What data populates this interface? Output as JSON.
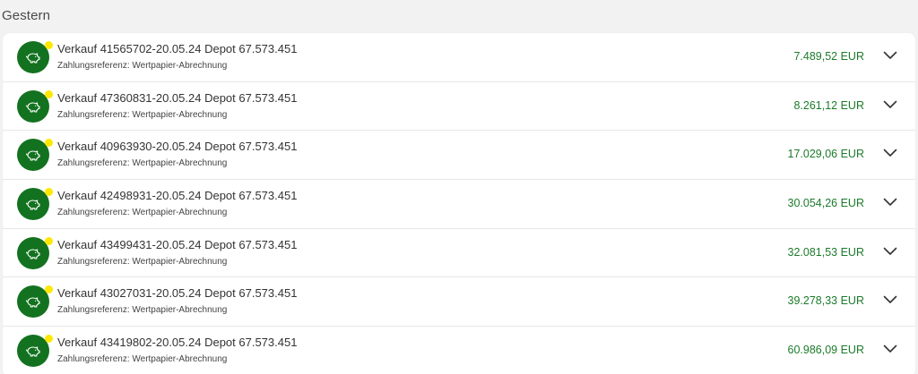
{
  "section": {
    "heading": "Gestern"
  },
  "colors": {
    "icon_bg": "#13721f",
    "notification_dot": "#ffe800",
    "amount": "#1c7a2b"
  },
  "transactions": [
    {
      "title": "Verkauf 41565702-20.05.24 Depot 67.573.451",
      "reference": "Zahlungsreferenz: Wertpapier-Abrechnung",
      "amount": "7.489,52 EUR",
      "icon": "piggy-bank-icon"
    },
    {
      "title": "Verkauf 47360831-20.05.24 Depot 67.573.451",
      "reference": "Zahlungsreferenz: Wertpapier-Abrechnung",
      "amount": "8.261,12 EUR",
      "icon": "piggy-bank-icon"
    },
    {
      "title": "Verkauf 40963930-20.05.24 Depot 67.573.451",
      "reference": "Zahlungsreferenz: Wertpapier-Abrechnung",
      "amount": "17.029,06 EUR",
      "icon": "piggy-bank-icon"
    },
    {
      "title": "Verkauf 42498931-20.05.24 Depot 67.573.451",
      "reference": "Zahlungsreferenz: Wertpapier-Abrechnung",
      "amount": "30.054,26 EUR",
      "icon": "piggy-bank-icon"
    },
    {
      "title": "Verkauf 43499431-20.05.24 Depot 67.573.451",
      "reference": "Zahlungsreferenz: Wertpapier-Abrechnung",
      "amount": "32.081,53 EUR",
      "icon": "piggy-bank-icon"
    },
    {
      "title": "Verkauf 43027031-20.05.24 Depot 67.573.451",
      "reference": "Zahlungsreferenz: Wertpapier-Abrechnung",
      "amount": "39.278,33 EUR",
      "icon": "piggy-bank-icon"
    },
    {
      "title": "Verkauf 43419802-20.05.24 Depot 67.573.451",
      "reference": "Zahlungsreferenz: Wertpapier-Abrechnung",
      "amount": "60.986,09 EUR",
      "icon": "piggy-bank-icon"
    }
  ]
}
